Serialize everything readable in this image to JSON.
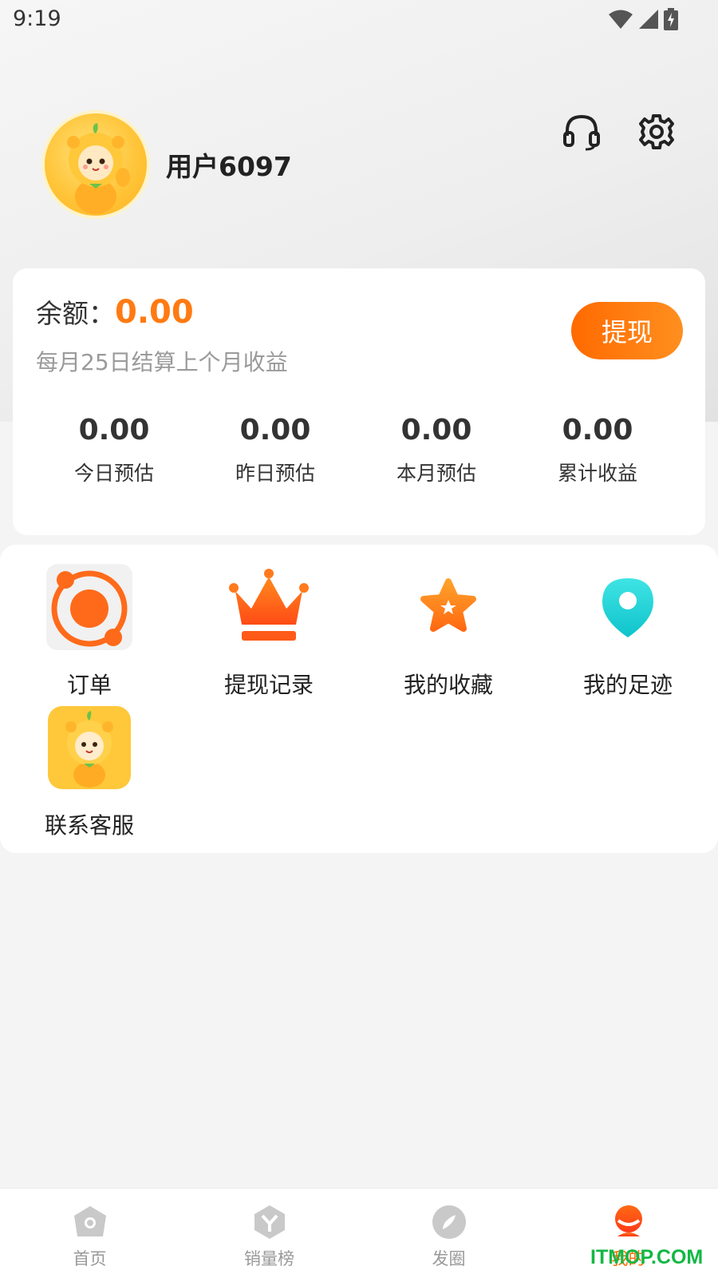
{
  "status_bar": {
    "time": "9:19"
  },
  "profile": {
    "username": "用户6097"
  },
  "balance": {
    "label": "余额：",
    "value": "0.00",
    "note": "每月25日结算上个月收益",
    "withdraw_button": "提现"
  },
  "stats": [
    {
      "value": "0.00",
      "label": "今日预估"
    },
    {
      "value": "0.00",
      "label": "昨日预估"
    },
    {
      "value": "0.00",
      "label": "本月预估"
    },
    {
      "value": "0.00",
      "label": "累计收益"
    }
  ],
  "menu": [
    {
      "label": "订单",
      "icon": "order-ring-icon"
    },
    {
      "label": "提现记录",
      "icon": "crown-icon"
    },
    {
      "label": "我的收藏",
      "icon": "star-icon"
    },
    {
      "label": "我的足迹",
      "icon": "location-pin-icon"
    },
    {
      "label": "联系客服",
      "icon": "mascot-icon"
    }
  ],
  "bottom_nav": [
    {
      "label": "首页",
      "icon": "home-icon",
      "active": false
    },
    {
      "label": "销量榜",
      "icon": "ranking-icon",
      "active": false
    },
    {
      "label": "发圈",
      "icon": "compass-icon",
      "active": false
    },
    {
      "label": "我的",
      "icon": "profile-icon",
      "active": true
    }
  ],
  "watermark": "ITMOP.COM",
  "colors": {
    "accent": "#ff7a12",
    "teal": "#18d3d8",
    "active": "#ff6a00"
  }
}
